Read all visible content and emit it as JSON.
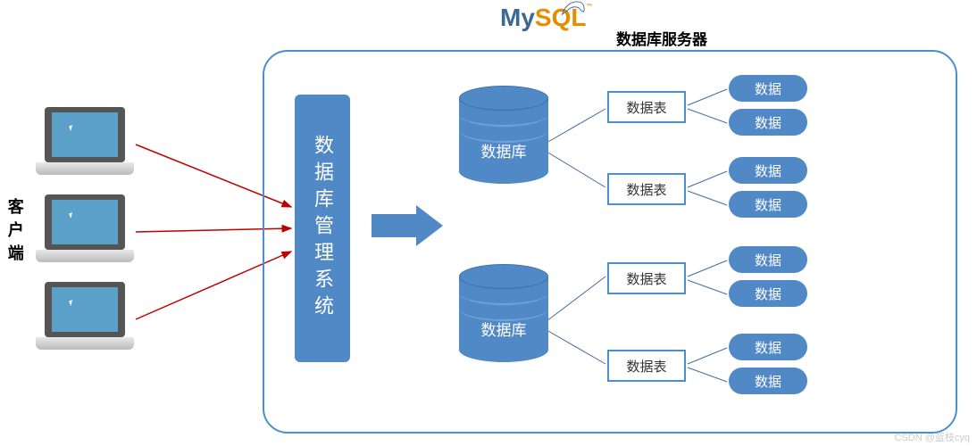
{
  "clientLabel": "客户端",
  "logoMy": "My",
  "logoSQL": "SQL",
  "logoTM": "™",
  "serverLabel": "数据库服务器",
  "dbms": "数据库管理系统",
  "databases": [
    {
      "label": "数据库"
    },
    {
      "label": "数据库"
    }
  ],
  "tables": [
    {
      "label": "数据表"
    },
    {
      "label": "数据表"
    },
    {
      "label": "数据表"
    },
    {
      "label": "数据表"
    }
  ],
  "data": [
    {
      "label": "数据"
    },
    {
      "label": "数据"
    },
    {
      "label": "数据"
    },
    {
      "label": "数据"
    },
    {
      "label": "数据"
    },
    {
      "label": "数据"
    },
    {
      "label": "数据"
    },
    {
      "label": "数据"
    }
  ],
  "watermark": "CSDN @蓝枝cyq"
}
